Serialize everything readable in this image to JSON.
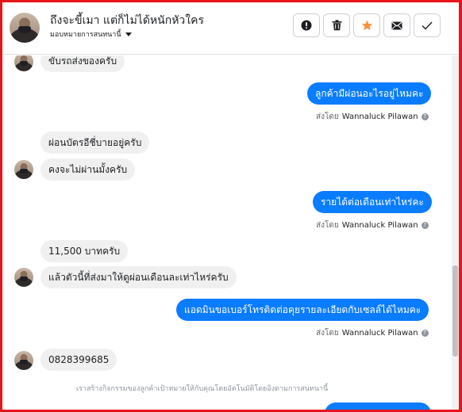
{
  "header": {
    "title": "ถึงจะขี้เมา แต่ก็ไม่ได้หนักหัวใคร",
    "assign_label": "มอบหมายการสนทนานี้",
    "actions": [
      {
        "name": "report-button",
        "icon": "exclamation-icon"
      },
      {
        "name": "delete-button",
        "icon": "trash-icon"
      },
      {
        "name": "star-button",
        "icon": "star-icon",
        "color": "#f7923b"
      },
      {
        "name": "mail-button",
        "icon": "envelope-icon"
      },
      {
        "name": "done-button",
        "icon": "check-icon"
      }
    ]
  },
  "messages": [
    {
      "side": "in",
      "text": "ขับรถส่งของครับ"
    },
    {
      "side": "out",
      "text": "ลูกค้ามีผ่อนอะไรอยู่ไหมคะ",
      "sent_by_prefix": "ส่งโดย",
      "sent_by_name": "Wannaluck Pilawan"
    },
    {
      "side": "in",
      "text": "ผ่อนบัตรอีชี่บายอยู่ครับ"
    },
    {
      "side": "in",
      "text": "คงจะไม่ผ่านมั้งครับ"
    },
    {
      "side": "out",
      "text": "รายได้ต่อเดือนเท่าไหร่คะ",
      "sent_by_prefix": "ส่งโดย",
      "sent_by_name": "Wannaluck Pilawan"
    },
    {
      "side": "in",
      "text": "11,500 บาทครับ"
    },
    {
      "side": "in",
      "text": "แล้วตัวนี้ที่ส่งมาให้ดูผ่อนเดือนละเท่าไหร่ครับ"
    },
    {
      "side": "out",
      "text": "แอดมินขอเบอร์โทรติดต่อคุยรายละเอียดกับเซลล์ได้ไหมคะ",
      "sent_by_prefix": "ส่งโดย",
      "sent_by_name": "Wannaluck Pilawan"
    },
    {
      "side": "in",
      "text": "0828399685"
    }
  ],
  "system_note": "เราสร้างกิจกรรมของลูกค้าเป้าหมายให้กับคุณโดยอัตโนมัติโดยอิงตามการสนทนานี้",
  "colors": {
    "accent": "#0a7cff",
    "incoming": "#f0f0f0",
    "frame": "#e8141c"
  }
}
